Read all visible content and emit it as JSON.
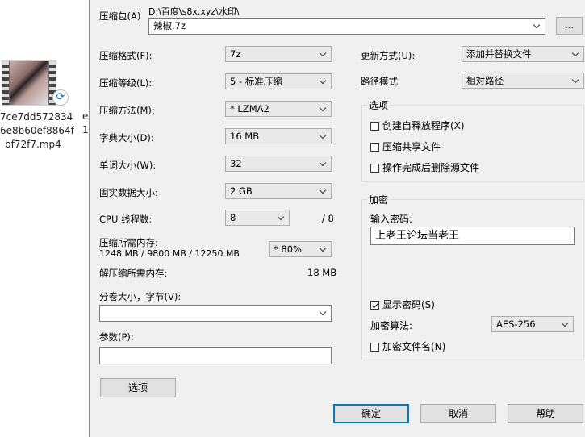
{
  "explorer": {
    "file_name_lines": [
      "7ce7dd572834",
      "6e8b60ef8864f",
      "bf72f7.mp4"
    ],
    "peek_lines": [
      "e",
      "1"
    ],
    "sync_icon": "sync-icon"
  },
  "archive": {
    "label": "压缩包(A)",
    "path": "D:\\百度\\s8x.xyz\\水印\\",
    "name": "辣椒.7z",
    "browse_label": "..."
  },
  "left": {
    "format": {
      "label": "压缩格式(F):",
      "value": "7z"
    },
    "level": {
      "label": "压缩等级(L):",
      "value": "5 - 标准压缩"
    },
    "method": {
      "label": "压缩方法(M):",
      "value": "*  LZMA2"
    },
    "dict": {
      "label": "字典大小(D):",
      "value": "16 MB"
    },
    "word": {
      "label": "单词大小(W):",
      "value": "32"
    },
    "solid": {
      "label": "固实数据大小:",
      "value": "2 GB"
    },
    "cpu": {
      "label": "CPU 线程数:",
      "value": "8",
      "max": "/ 8"
    },
    "memory": {
      "label": "压缩所需内存:",
      "detail": "1248 MB / 9800 MB / 12250 MB",
      "value": "* 80%"
    },
    "decomp": {
      "label": "解压缩所需内存:",
      "value": "18 MB"
    },
    "split": {
      "label": "分卷大小，字节(V):",
      "value": ""
    },
    "params": {
      "label": "参数(P):",
      "value": ""
    },
    "options_button": "选项"
  },
  "right": {
    "update": {
      "label": "更新方式(U):",
      "value": "添加并替换文件"
    },
    "path_mode": {
      "label": "路径模式",
      "value": "相对路径"
    },
    "options": {
      "title": "选项",
      "sfx": {
        "label": "创建自释放程序(X)",
        "checked": false
      },
      "shared": {
        "label": "压缩共享文件",
        "checked": false
      },
      "delete": {
        "label": "操作完成后删除源文件",
        "checked": false
      }
    },
    "encryption": {
      "title": "加密",
      "password_label": "输入密码:",
      "password": "上老王论坛当老王",
      "show_password": {
        "label": "显示密码(S)",
        "checked": true
      },
      "method_label": "加密算法:",
      "method": "AES-256",
      "encrypt_names": {
        "label": "加密文件名(N)",
        "checked": false
      }
    }
  },
  "buttons": {
    "ok": "确定",
    "cancel": "取消",
    "help": "帮助"
  }
}
